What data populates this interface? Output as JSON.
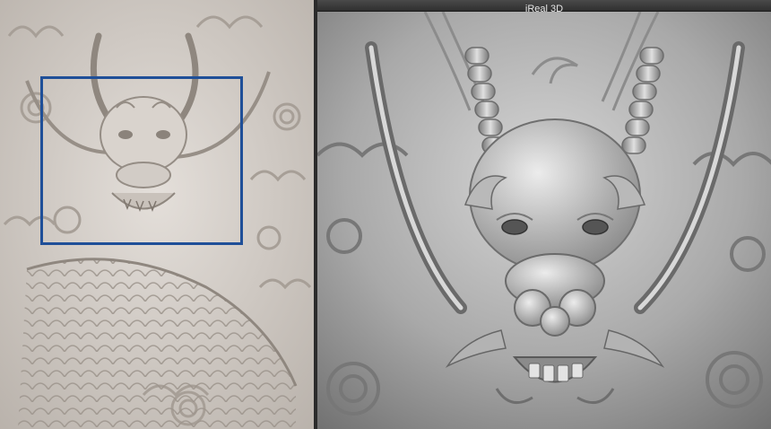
{
  "app": {
    "title": "iReal 3D"
  },
  "photo_pane": {
    "subject": "dragon-relief-carving-photo",
    "selection_color": "#1f4f98"
  },
  "viewport": {
    "subject": "dragon-head-3d-relief-model",
    "surface_color": "#a8a8a8"
  }
}
